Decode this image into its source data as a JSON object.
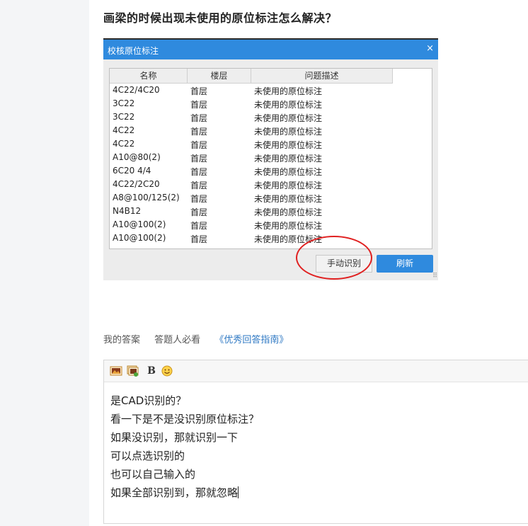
{
  "question": {
    "title": "画梁的时候出现未使用的原位标注怎么解决？"
  },
  "dialog": {
    "title": "校核原位标注",
    "close_glyph": "×",
    "columns": [
      "名称",
      "楼层",
      "问题描述"
    ],
    "rows": [
      {
        "name": "4C22/4C20",
        "floor": "首层",
        "desc": "未使用的原位标注"
      },
      {
        "name": "3C22",
        "floor": "首层",
        "desc": "未使用的原位标注"
      },
      {
        "name": "3C22",
        "floor": "首层",
        "desc": "未使用的原位标注"
      },
      {
        "name": "4C22",
        "floor": "首层",
        "desc": "未使用的原位标注"
      },
      {
        "name": "4C22",
        "floor": "首层",
        "desc": "未使用的原位标注"
      },
      {
        "name": "A10@80(2)",
        "floor": "首层",
        "desc": "未使用的原位标注"
      },
      {
        "name": "6C20 4/4",
        "floor": "首层",
        "desc": "未使用的原位标注"
      },
      {
        "name": "4C22/2C20",
        "floor": "首层",
        "desc": "未使用的原位标注"
      },
      {
        "name": "A8@100/125(2)",
        "floor": "首层",
        "desc": "未使用的原位标注"
      },
      {
        "name": "N4B12",
        "floor": "首层",
        "desc": "未使用的原位标注"
      },
      {
        "name": "A10@100(2)",
        "floor": "首层",
        "desc": "未使用的原位标注"
      },
      {
        "name": "A10@100(2)",
        "floor": "首层",
        "desc": "未使用的原位标注"
      }
    ],
    "buttons": {
      "manual": "手动识别",
      "refresh": "刷新"
    },
    "colors": {
      "titlebar": "#2f8ade",
      "highlight_circle": "#e02020"
    }
  },
  "answer_tabs": {
    "my_answer": "我的答案",
    "must_read": "答题人必看",
    "guide": "《优秀回答指南》"
  },
  "editor": {
    "toolbar_icons": [
      "image-icon",
      "album-icon",
      "bold-icon",
      "emoji-icon"
    ],
    "bold_glyph": "B",
    "lines": [
      "是CAD识别的？",
      "看一下是不是没识别原位标注？",
      "如果没识别，那就识别一下",
      "可以点选识别的",
      "也可以自己输入的",
      "如果全部识别到，那就忽略"
    ]
  }
}
